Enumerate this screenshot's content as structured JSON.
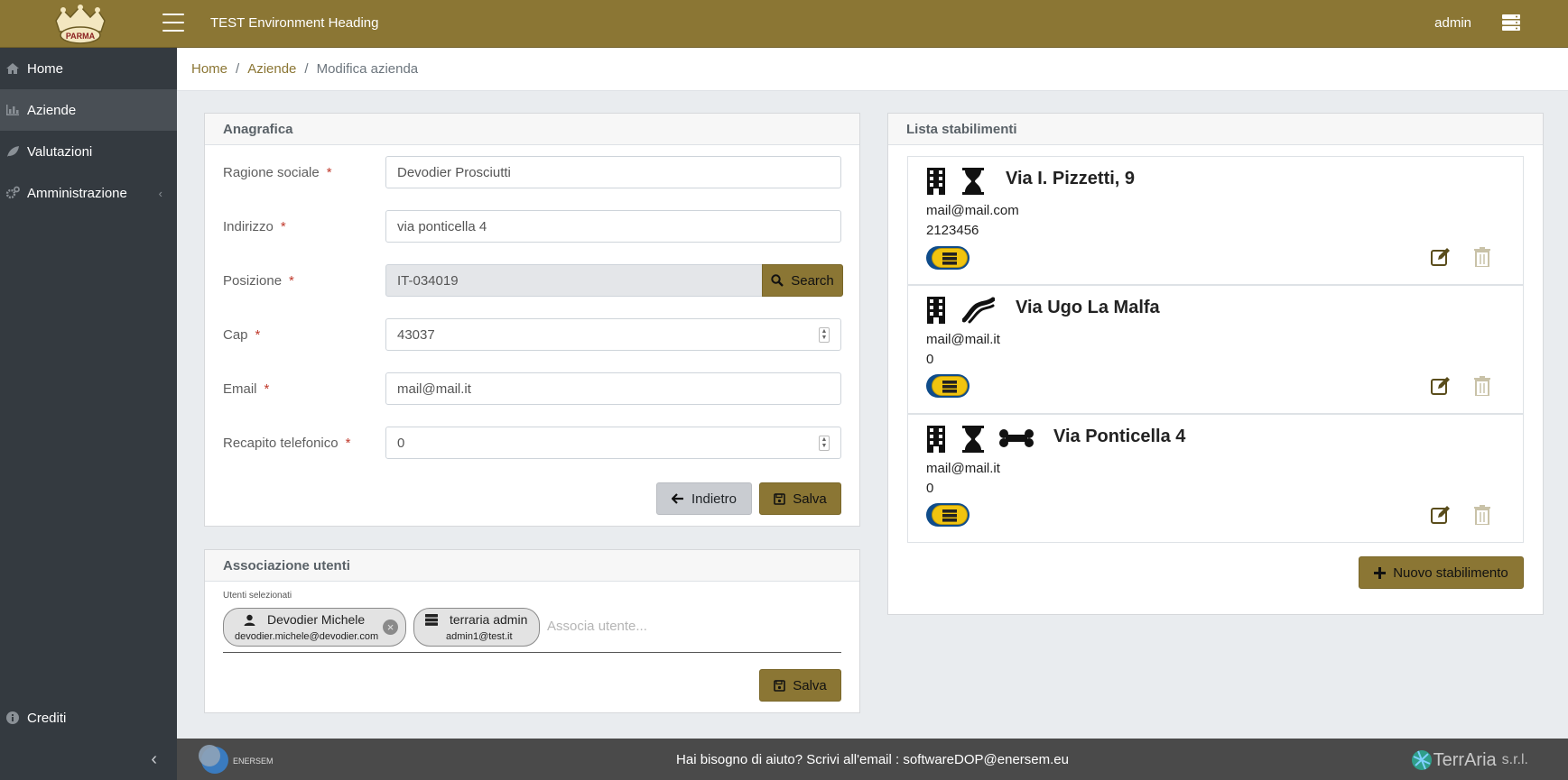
{
  "header": {
    "logo_text": "PARMA",
    "env_title": "TEST Environment Heading",
    "user": "admin"
  },
  "sidebar": {
    "items": [
      {
        "label": "Home",
        "icon": "home-icon"
      },
      {
        "label": "Aziende",
        "icon": "chart-icon",
        "active": true
      },
      {
        "label": "Valutazioni",
        "icon": "leaf-icon"
      },
      {
        "label": "Amministrazione",
        "icon": "cogs-icon"
      }
    ],
    "bottom_item": {
      "label": "Crediti",
      "icon": "info-icon"
    }
  },
  "breadcrumb": {
    "items": [
      "Home",
      "Aziende"
    ],
    "current": "Modifica azienda"
  },
  "anagrafica": {
    "title": "Anagrafica",
    "fields": {
      "ragione_sociale": {
        "label": "Ragione sociale",
        "value": "Devodier Prosciutti"
      },
      "indirizzo": {
        "label": "Indirizzo",
        "value": "via ponticella 4"
      },
      "posizione": {
        "label": "Posizione",
        "value": "IT-034019"
      },
      "cap": {
        "label": "Cap",
        "value": "43037"
      },
      "email": {
        "label": "Email",
        "value": "mail@mail.it"
      },
      "telefono": {
        "label": "Recapito telefonico",
        "value": "0"
      }
    },
    "search_label": "Search",
    "back_label": "Indietro",
    "save_label": "Salva"
  },
  "associazione": {
    "title": "Associazione utenti",
    "selected_label": "Utenti selezionati",
    "users": [
      {
        "name": "Devodier Michele",
        "email": "devodier.michele@devodier.com",
        "icon": "user-icon"
      },
      {
        "name": "terraria admin",
        "email": "admin1@test.it",
        "icon": "server-icon"
      }
    ],
    "placeholder": "Associa utente...",
    "save_label": "Salva"
  },
  "stabilimenti": {
    "title": "Lista stabilimenti",
    "items": [
      {
        "address": "Via I. Pizzetti, 9",
        "email": "mail@mail.com",
        "phone": "2123456",
        "icons": [
          "building-icon",
          "hourglass-icon"
        ]
      },
      {
        "address": "Via Ugo La Malfa",
        "email": "mail@mail.it",
        "phone": "0",
        "icons": [
          "building-icon",
          "sliced-ham-icon"
        ]
      },
      {
        "address": "Via Ponticella 4",
        "email": "mail@mail.it",
        "phone": "0",
        "icons": [
          "building-icon",
          "hourglass-icon",
          "bone-icon"
        ]
      }
    ],
    "new_label": "Nuovo stabilimento"
  },
  "footer": {
    "help_text": "Hai bisogno di aiuto? Scrivi all'email :  softwareDOP@enersem.eu",
    "enersem_logo": "ENERSEM",
    "terraria_name": "TerrAria",
    "terraria_suffix": "s.r.l."
  },
  "colors": {
    "brand": "#8b7634",
    "sidebar": "#343a40",
    "footer": "#4a4a4a",
    "required": "#c0392b"
  }
}
